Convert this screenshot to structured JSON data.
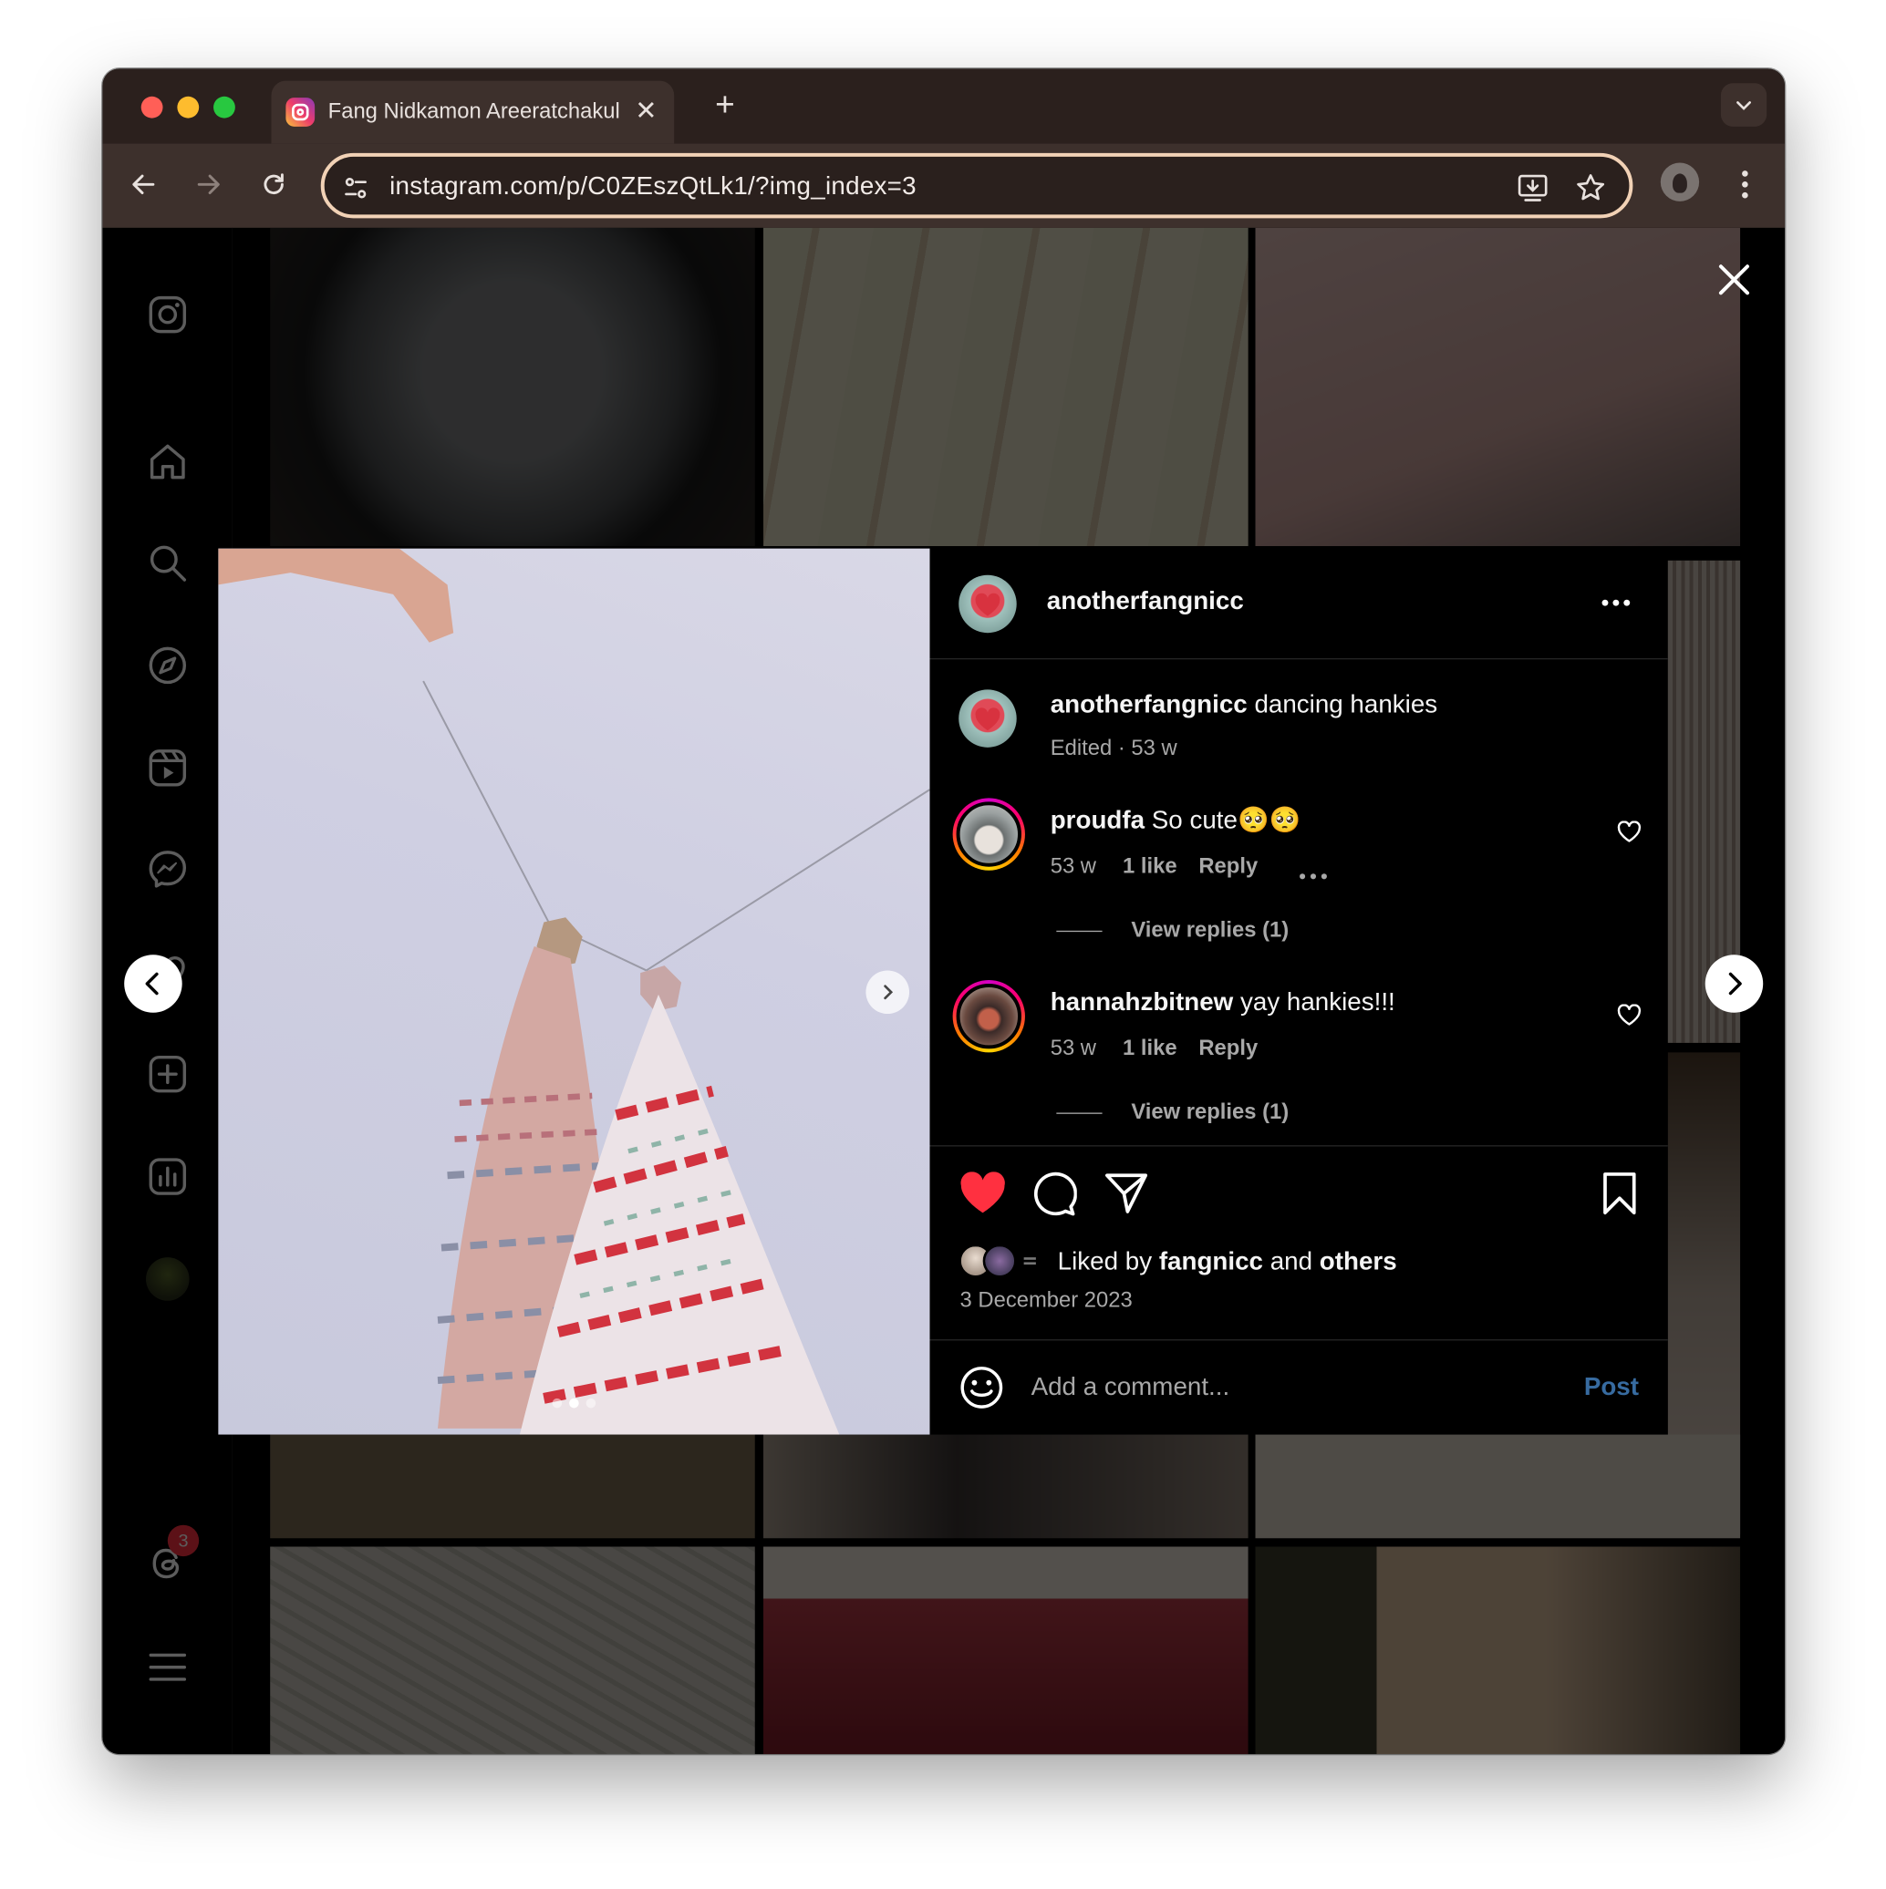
{
  "browser": {
    "tab_title": "Fang Nidkamon Areeratchakul",
    "url": "instagram.com/p/C0ZEszQtLk1/?img_index=3",
    "new_tab_label": "+"
  },
  "sidebar": {
    "notification_count": "3",
    "icons": [
      "instagram-logo-icon",
      "home-icon",
      "search-icon",
      "explore-icon",
      "reels-icon",
      "messenger-icon",
      "heart-icon",
      "create-icon",
      "insights-icon",
      "profile-avatar",
      "threads-icon",
      "menu-icon"
    ]
  },
  "post": {
    "author": "anotherfangnicc",
    "caption_user": "anotherfangnicc",
    "caption_text": " dancing hankies",
    "caption_meta": "Edited · 53 w",
    "comments": [
      {
        "user": "proudfa",
        "text": " So cute🥺🥺",
        "age": "53 w",
        "likes": "1 like",
        "reply": "Reply",
        "view_replies": "View replies (1)"
      },
      {
        "user": "hannahzbitnew",
        "text": " yay hankies!!!",
        "age": "53 w",
        "likes": "1 like",
        "reply": "Reply",
        "view_replies": "View replies (1)"
      }
    ],
    "liked_prefix": "Liked by ",
    "liked_user": "fangnicc",
    "liked_and": " and ",
    "liked_others": "others",
    "date": "3 December 2023",
    "liked": true,
    "comment_placeholder": "Add a comment...",
    "post_button": "Post",
    "carousel_dots": 3,
    "carousel_active": 1
  },
  "colors": {
    "like_red": "#ff3040",
    "post_blue": "#4a8fd6",
    "tab_bar": "#2b201d",
    "toolbar": "#3d302c",
    "omnibox_border": "#f2d2b6"
  }
}
